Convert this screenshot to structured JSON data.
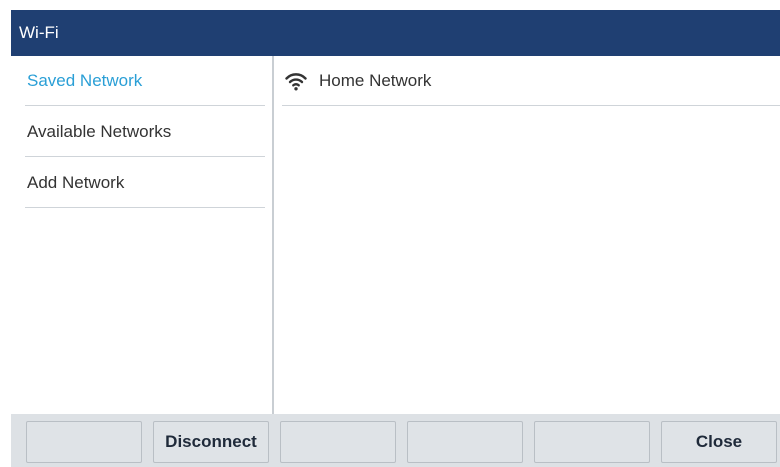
{
  "window": {
    "title": "Wi-Fi"
  },
  "sidebar": {
    "items": [
      {
        "label": "Saved Network",
        "active": true
      },
      {
        "label": "Available Networks",
        "active": false
      },
      {
        "label": "Add Network",
        "active": false
      }
    ]
  },
  "networks": [
    {
      "name": "Home Network",
      "icon": "wifi-icon"
    }
  ],
  "softkeys": [
    {
      "label": ""
    },
    {
      "label": "Disconnect"
    },
    {
      "label": ""
    },
    {
      "label": ""
    },
    {
      "label": ""
    },
    {
      "label": "Close"
    }
  ],
  "colors": {
    "titlebar": "#1f3f72",
    "active_item": "#2a9fd6",
    "softkey_bar": "#dde1e5"
  }
}
